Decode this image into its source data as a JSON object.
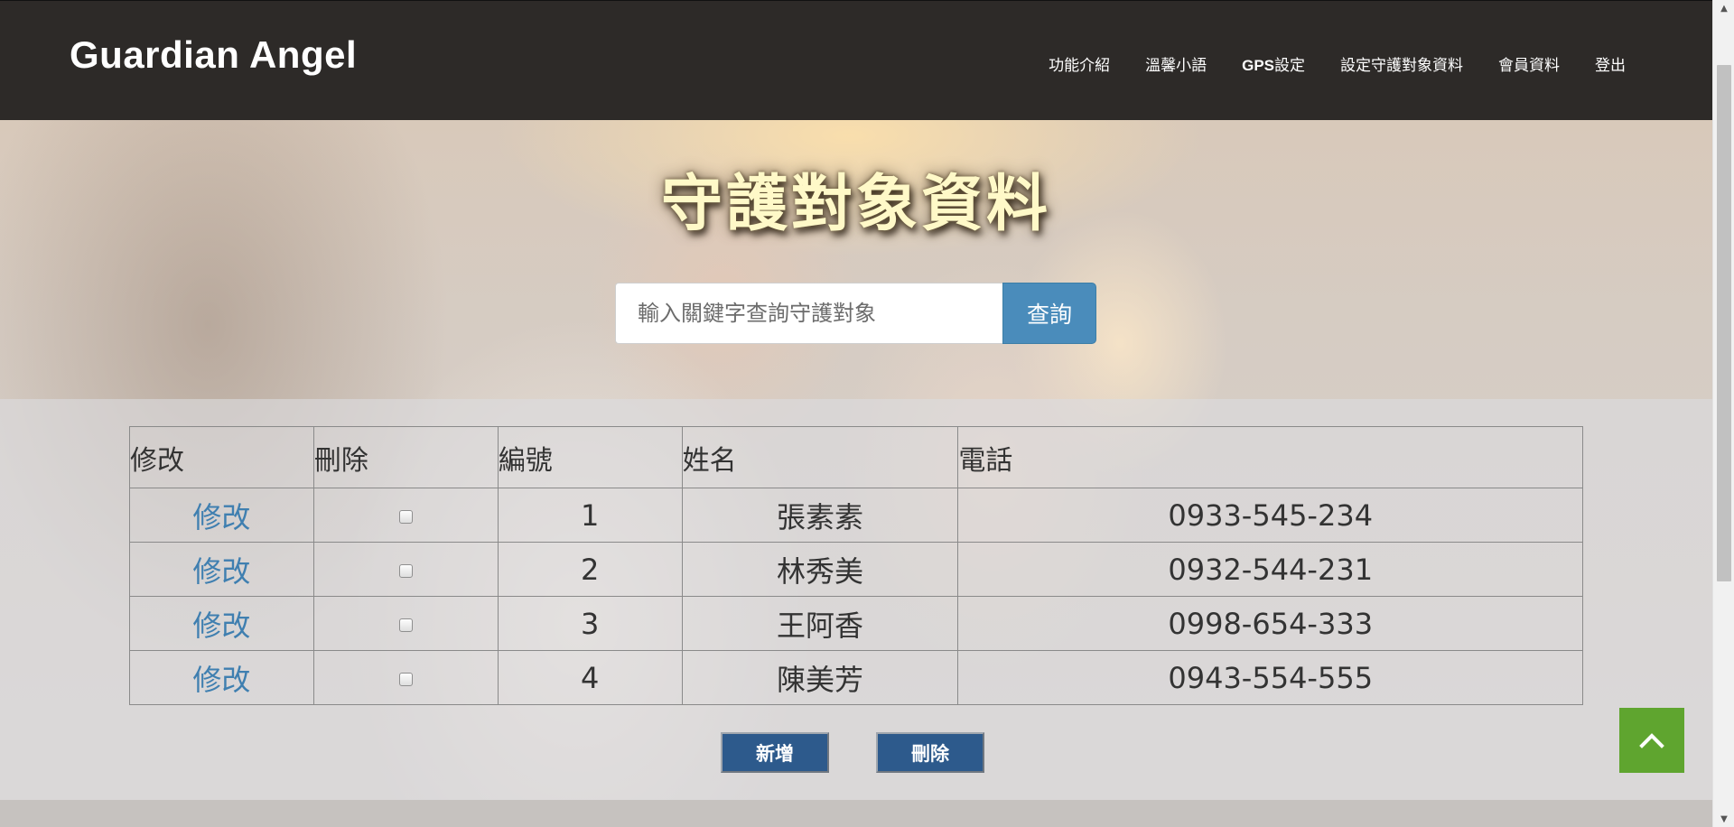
{
  "brand": "Guardian Angel",
  "nav": {
    "items": [
      {
        "label": "功能介紹"
      },
      {
        "label": "溫馨小語"
      },
      {
        "label_bold": "GPS",
        "label_rest": "設定"
      },
      {
        "label": "設定守護對象資料"
      },
      {
        "label": "會員資料"
      },
      {
        "label": "登出"
      }
    ]
  },
  "hero": {
    "title": "守護對象資料"
  },
  "search": {
    "placeholder": "輸入關鍵字查詢守護對象",
    "button_label": "查詢"
  },
  "table": {
    "headers": [
      "修改",
      "刪除",
      "編號",
      "姓名",
      "電話"
    ],
    "rows": [
      {
        "edit": "修改",
        "id": "1",
        "name": "張素素",
        "phone": "0933-545-234"
      },
      {
        "edit": "修改",
        "id": "2",
        "name": "林秀美",
        "phone": "0932-544-231"
      },
      {
        "edit": "修改",
        "id": "3",
        "name": "王阿香",
        "phone": "0998-654-333"
      },
      {
        "edit": "修改",
        "id": "4",
        "name": "陳美芳",
        "phone": "0943-554-555"
      }
    ]
  },
  "actions": {
    "add_label": "新增",
    "delete_label": "刪除"
  },
  "icons": {
    "back_to_top": "chevron-up-icon"
  },
  "colors": {
    "accent_blue": "#4a8cbb",
    "button_navy": "#2d5a8c",
    "back_to_top_green": "#5fa52f",
    "title_yellow": "#fff9c8"
  }
}
